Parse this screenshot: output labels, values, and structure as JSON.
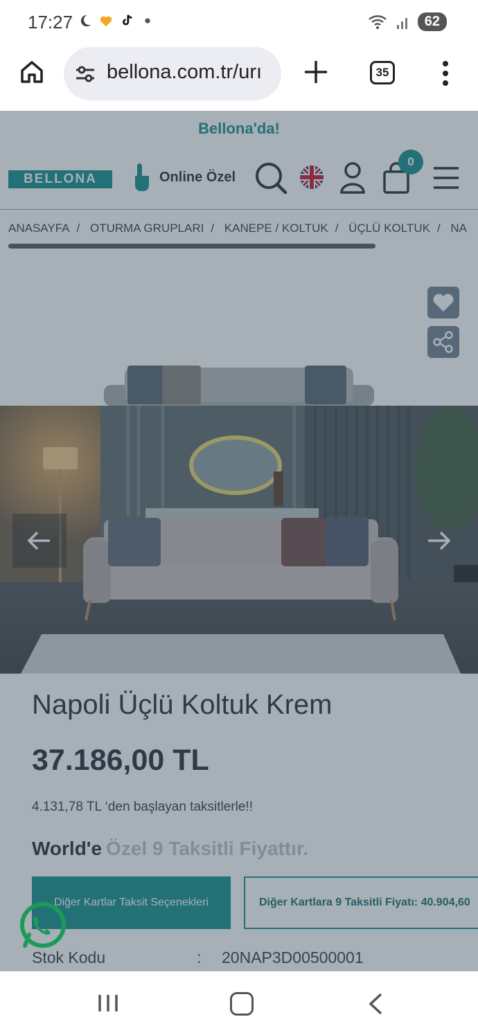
{
  "status_bar": {
    "time": "17:27",
    "battery": "62"
  },
  "browser": {
    "url": "bellona.com.tr/urı",
    "tab_count": "35"
  },
  "site": {
    "promo_text": "Bellona'da!",
    "logo_text": "BELLONA",
    "online_label": "Online Özel",
    "cart_count": "0",
    "breadcrumb": [
      "ANASAYFA",
      "OTURMA GRUPLARI",
      "KANEPE / KOLTUK",
      "ÜÇLÜ KOLTUK",
      "NA"
    ],
    "product": {
      "title": "Napoli Üçlü Koltuk Krem",
      "price": "37.186,00 TL",
      "installment_text": "4.131,78 TL ‘den başlayan taksitlerle!!",
      "worlds_prefix": "World'e",
      "worlds_suffix": "Özel 9 Taksitli Fiyattır.",
      "btn_other_cards": "Diğer Kartlar Taksit Seçenekleri",
      "btn_other_cards_price": "Diğer Kartlara 9 Taksitli Fiyatı: 40.904,60",
      "stock_label": "Stok Kodu",
      "stock_colon": ":",
      "stock_value": "20NAP3D00500001"
    }
  },
  "colors": {
    "brand": "#0f8a8a",
    "overlay": "rgba(60,80,95,0.45)"
  },
  "icons": [
    "home-icon",
    "tune-icon",
    "plus-icon",
    "tabs-icon",
    "more-vert-icon",
    "hand-pointer-icon",
    "search-icon",
    "uk-flag-icon",
    "user-icon",
    "cart-icon",
    "hamburger-icon",
    "heart-icon",
    "share-icon",
    "arrow-left-icon",
    "arrow-right-icon",
    "whatsapp-icon"
  ]
}
